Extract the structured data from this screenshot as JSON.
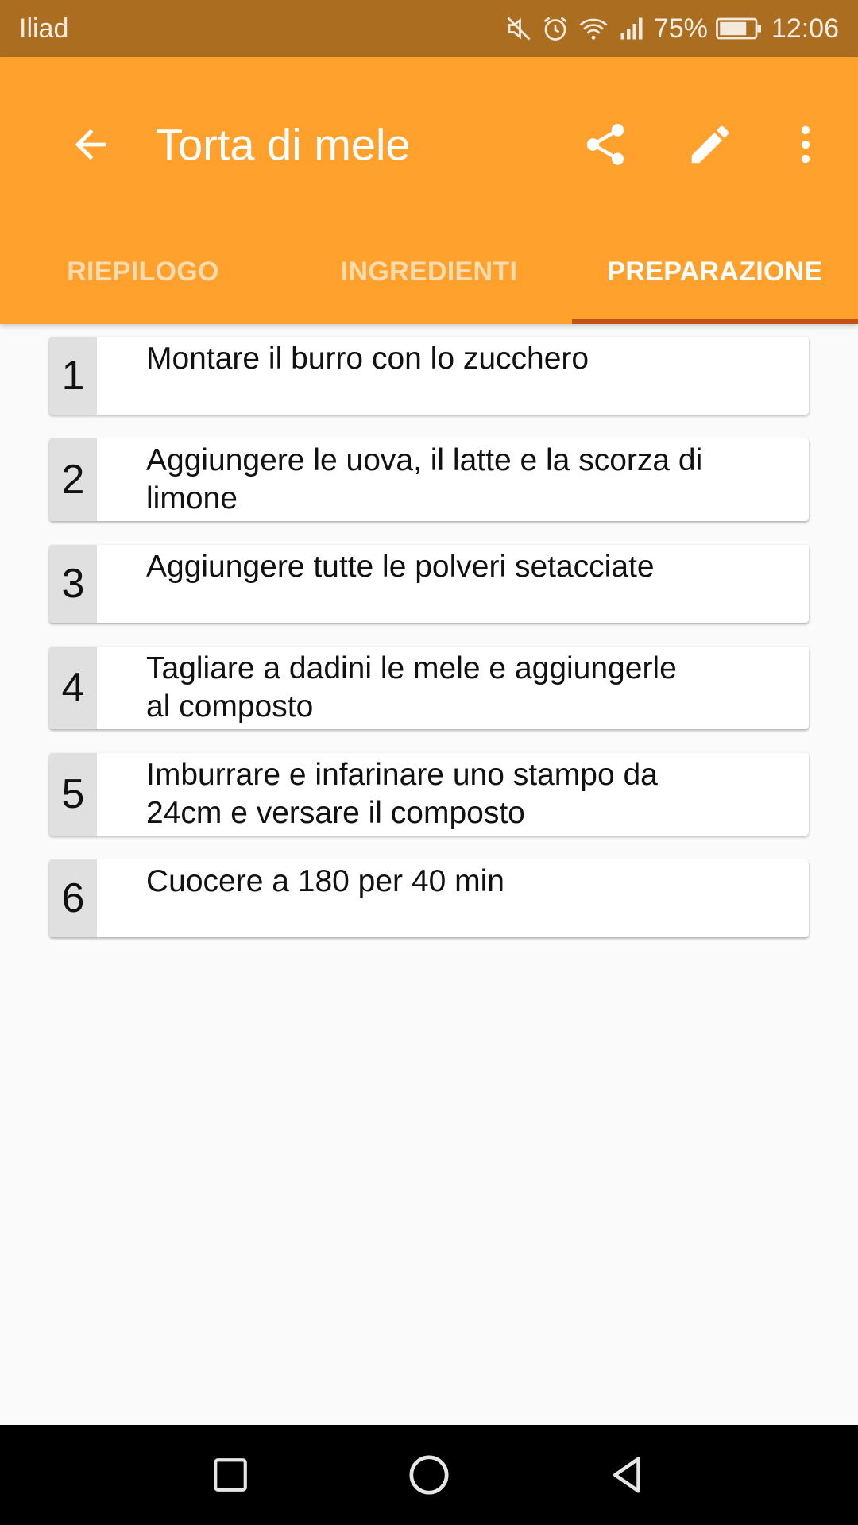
{
  "status_bar": {
    "carrier": "Iliad",
    "battery": "75%",
    "time": "12:06",
    "icons": [
      "mute-icon",
      "alarm-icon",
      "wifi-icon",
      "signal-icon",
      "battery-icon"
    ]
  },
  "toolbar": {
    "title": "Torta di mele",
    "back_icon": "arrow-back-icon",
    "actions": [
      "share-icon",
      "edit-icon",
      "more-vert-icon"
    ]
  },
  "tabs": [
    {
      "label": "RIEPILOGO",
      "active": false
    },
    {
      "label": "INGREDIENTI",
      "active": false
    },
    {
      "label": "PREPARAZIONE",
      "active": true
    }
  ],
  "steps": [
    {
      "number": "1",
      "text": "Montare il burro con lo zucchero"
    },
    {
      "number": "2",
      "text_lines": [
        "Aggiungere le uova, il latte e la scorza di",
        "limone"
      ]
    },
    {
      "number": "3",
      "text": "Aggiungere tutte le polveri setacciate"
    },
    {
      "number": "4",
      "text_lines": [
        "Tagliare a dadini le mele e aggiungerle",
        "al composto"
      ]
    },
    {
      "number": "5",
      "text_lines": [
        "Imburrare e infarinare uno stampo da",
        "24cm e versare il composto"
      ]
    },
    {
      "number": "6",
      "text": "Cuocere a 180 per 40 min"
    }
  ],
  "nav_bar": {
    "buttons": [
      "recents-square-icon",
      "home-circle-icon",
      "back-triangle-icon"
    ]
  },
  "colors": {
    "app_bar": "#ffa12c",
    "status_bar": "#ab6d1f",
    "tab_indicator": "#c0501a",
    "background": "#fafafa",
    "step_number_bg": "#e0e0e0"
  }
}
